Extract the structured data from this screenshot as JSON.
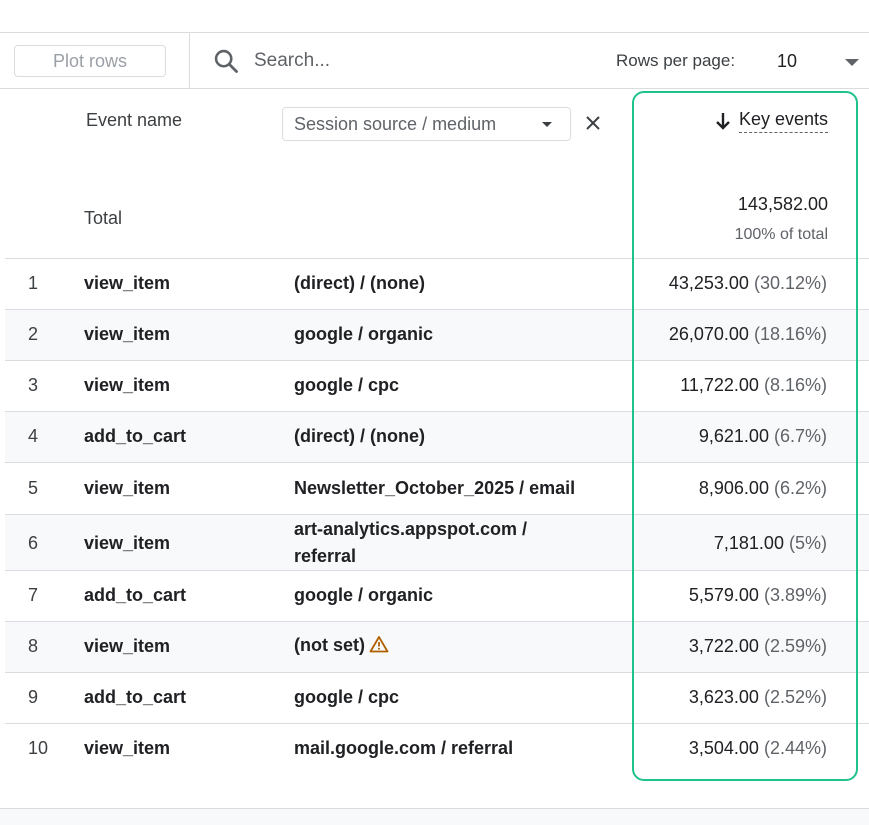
{
  "toolbar": {
    "plot_rows_label": "Plot rows",
    "search_placeholder": "Search...",
    "rows_per_page_label": "Rows per page:",
    "rows_per_page_value": "10"
  },
  "table": {
    "col_event_name": "Event name",
    "secondary_dimension": "Session source / medium",
    "metric_header": "Key events",
    "sort_direction": "descending",
    "total_label": "Total",
    "total_value": "143,582.00",
    "total_pct": "100% of total",
    "rows": [
      {
        "num": "1",
        "event": "view_item",
        "source": "(direct) / (none)",
        "value": "43,253.00",
        "pct": "(30.12%)"
      },
      {
        "num": "2",
        "event": "view_item",
        "source": "google / organic",
        "value": "26,070.00",
        "pct": "(18.16%)"
      },
      {
        "num": "3",
        "event": "view_item",
        "source": "google / cpc",
        "value": "11,722.00",
        "pct": "(8.16%)"
      },
      {
        "num": "4",
        "event": "add_to_cart",
        "source": "(direct) / (none)",
        "value": "9,621.00",
        "pct": "(6.7%)"
      },
      {
        "num": "5",
        "event": "view_item",
        "source": "Newsletter_October_2025 / email",
        "value": "8,906.00",
        "pct": "(6.2%)"
      },
      {
        "num": "6",
        "event": "view_item",
        "source": "art-analytics.appspot.com / referral",
        "value": "7,181.00",
        "pct": "(5%)"
      },
      {
        "num": "7",
        "event": "add_to_cart",
        "source": "google / organic",
        "value": "5,579.00",
        "pct": "(3.89%)"
      },
      {
        "num": "8",
        "event": "view_item",
        "source": "(not set)",
        "value": "3,722.00",
        "pct": "(2.59%)"
      },
      {
        "num": "9",
        "event": "add_to_cart",
        "source": "google / cpc",
        "value": "3,623.00",
        "pct": "(2.52%)"
      },
      {
        "num": "10",
        "event": "view_item",
        "source": "mail.google.com / referral",
        "value": "3,504.00",
        "pct": "(2.44%)"
      }
    ]
  },
  "icons": {
    "search": "search-icon",
    "close": "close-icon",
    "sort": "arrow-down-icon",
    "warning": "warning-icon"
  },
  "colors": {
    "highlight": "#1ec28b",
    "warning": "#b06000",
    "row_alt": "#f8f9fa"
  }
}
